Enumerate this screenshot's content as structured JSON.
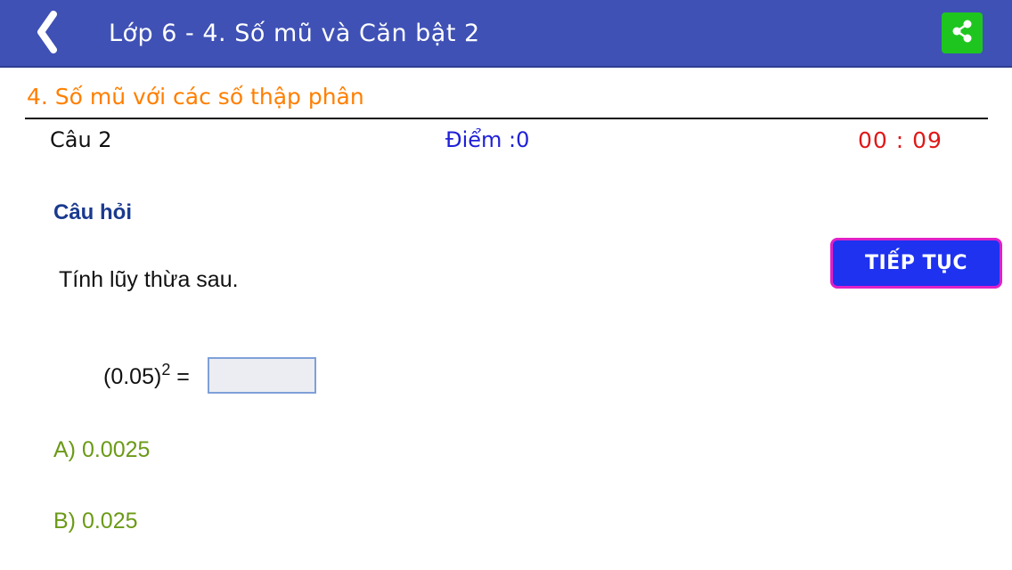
{
  "header": {
    "title": "Lớp 6 - 4. Số mũ và Căn bật 2",
    "back_icon": "back-chevron-icon",
    "share_icon": "share-icon",
    "share_color": "#1fc51f",
    "bar_color": "#3f51b5"
  },
  "section": {
    "title": "4. Số mũ với các số thập phân"
  },
  "status": {
    "question_number": "Câu  2",
    "score": "Điểm  :0",
    "timer": "00 : 09"
  },
  "question": {
    "heading": "Câu hỏi",
    "text": "Tính lũy thừa sau.",
    "expression_base": "(0.05)",
    "expression_exponent": "2",
    "expression_equals": "=",
    "answer_value": "",
    "answer_placeholder": ""
  },
  "actions": {
    "continue_label": "TIẾP TỤC"
  },
  "options": [
    {
      "label": "A) 0.0025"
    },
    {
      "label": "B) 0.025"
    }
  ]
}
